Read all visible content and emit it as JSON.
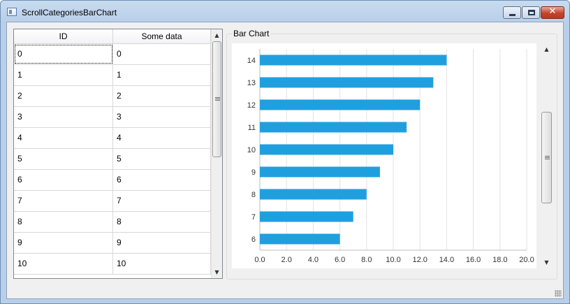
{
  "window": {
    "title": "ScrollCategoriesBarChart"
  },
  "table": {
    "headers": [
      "ID",
      "Some data"
    ],
    "rows": [
      [
        "0",
        "0"
      ],
      [
        "1",
        "1"
      ],
      [
        "2",
        "2"
      ],
      [
        "3",
        "3"
      ],
      [
        "4",
        "4"
      ],
      [
        "5",
        "5"
      ],
      [
        "6",
        "6"
      ],
      [
        "7",
        "7"
      ],
      [
        "8",
        "8"
      ],
      [
        "9",
        "9"
      ],
      [
        "10",
        "10"
      ]
    ]
  },
  "group": {
    "title": "Bar Chart"
  },
  "icons": {
    "window": "app-window-icon",
    "minimize": "minimize-icon",
    "maximize": "maximize-icon",
    "close": "close-icon",
    "scroll_up": "arrow-up-icon",
    "scroll_down": "arrow-down-icon",
    "grip": "scroll-grip-icon"
  },
  "glyphs": {
    "close": "✕",
    "up": "▲",
    "down": "▼"
  },
  "chart_data": {
    "type": "bar",
    "orientation": "horizontal",
    "categories": [
      "6",
      "7",
      "8",
      "9",
      "10",
      "11",
      "12",
      "13",
      "14"
    ],
    "values": [
      6,
      7,
      8,
      9,
      10,
      11,
      12,
      13,
      14
    ],
    "xlim": [
      0,
      20
    ],
    "x_ticks": [
      "0.0",
      "2.0",
      "4.0",
      "6.0",
      "8.0",
      "10.0",
      "12.0",
      "14.0",
      "16.0",
      "18.0",
      "20.0"
    ],
    "grid": true,
    "bar_color": "#209fdf"
  }
}
